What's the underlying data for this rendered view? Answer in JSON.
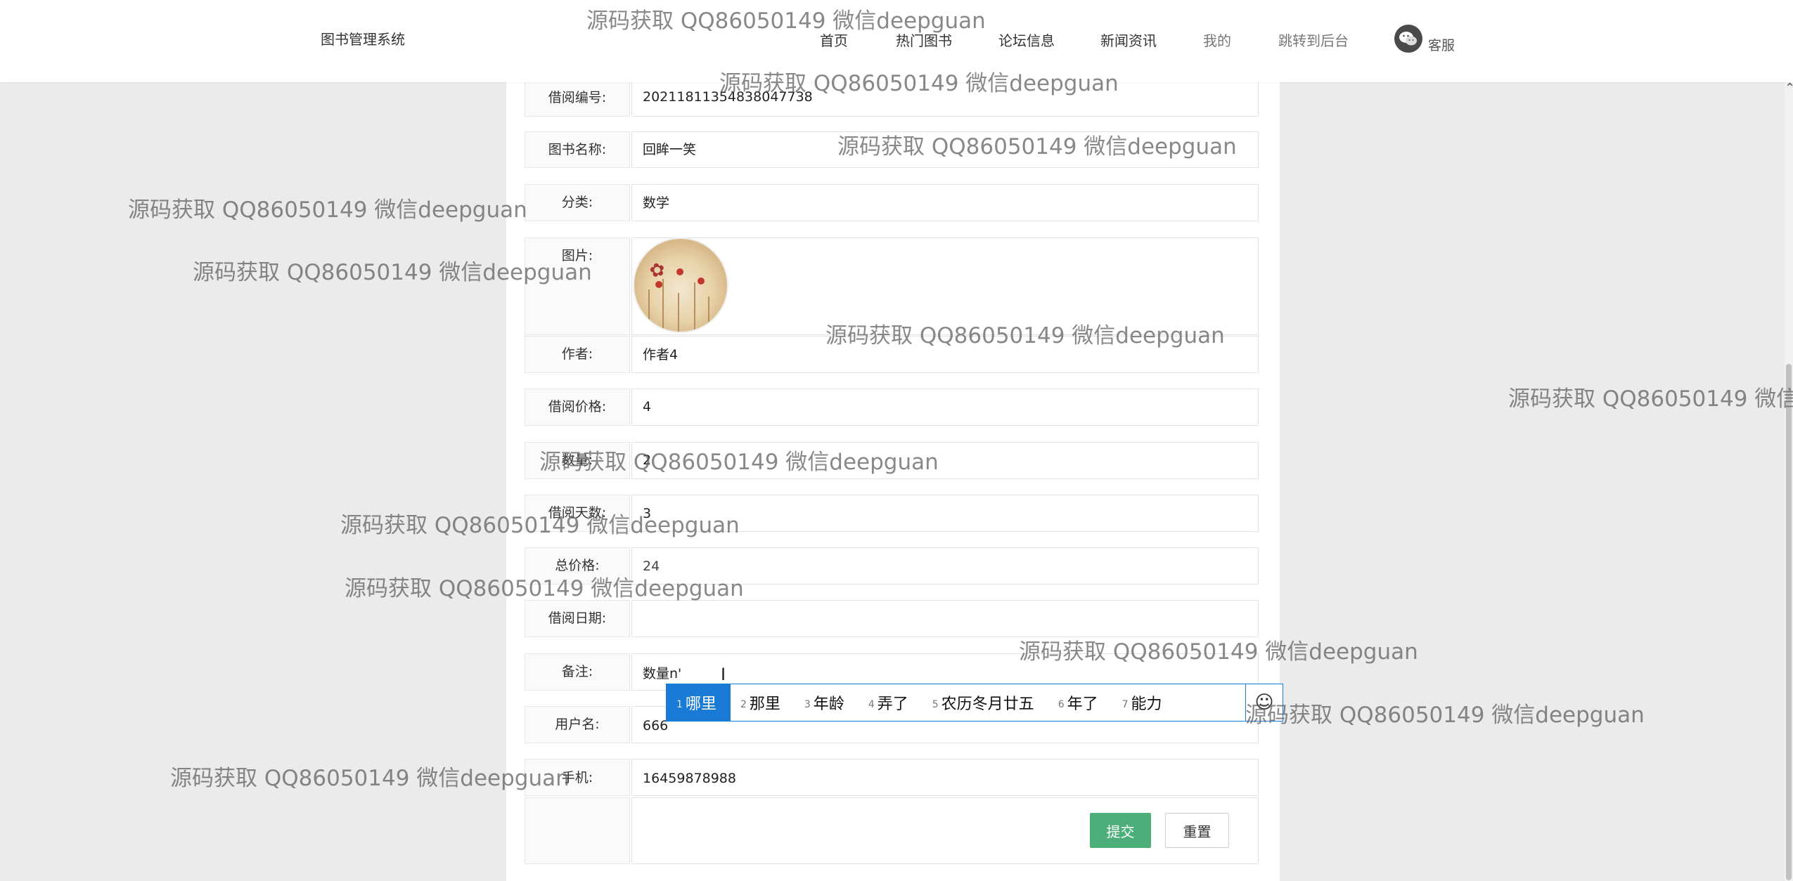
{
  "nav": {
    "brand": "图书管理系统",
    "items": [
      "首页",
      "热门图书",
      "论坛信息",
      "新闻资讯",
      "我的",
      "跳转到后台"
    ],
    "kefu": "客服"
  },
  "form": {
    "borrow_no": {
      "label": "借阅编号:",
      "value": "20211811354838047738"
    },
    "book_name": {
      "label": "图书名称:",
      "value": "回眸一笑"
    },
    "category": {
      "label": "分类:",
      "value": "数学"
    },
    "image": {
      "label": "图片:"
    },
    "author": {
      "label": "作者:",
      "value": "作者4"
    },
    "price": {
      "label": "借阅价格:",
      "value": "4"
    },
    "quantity": {
      "label": "数量:",
      "value": "2"
    },
    "days": {
      "label": "借阅天数:",
      "value": "3"
    },
    "total": {
      "label": "总价格:",
      "value": "24"
    },
    "date": {
      "label": "借阅日期:",
      "value": ""
    },
    "remark": {
      "label": "备注:",
      "value": "数量n'"
    },
    "username": {
      "label": "用户名:",
      "value": "666"
    },
    "phone": {
      "label": "手机:",
      "value": "16459878988"
    },
    "submit": "提交",
    "reset": "重置"
  },
  "ime": {
    "candidates": [
      {
        "num": "1",
        "text": "哪里"
      },
      {
        "num": "2",
        "text": "那里"
      },
      {
        "num": "3",
        "text": "年龄"
      },
      {
        "num": "4",
        "text": "弄了"
      },
      {
        "num": "5",
        "text": "农历冬月廿五"
      },
      {
        "num": "6",
        "text": "年了"
      },
      {
        "num": "7",
        "text": "能力"
      }
    ],
    "emoji": "☺"
  },
  "watermark": "源码获取 QQ86050149 微信deepguan"
}
